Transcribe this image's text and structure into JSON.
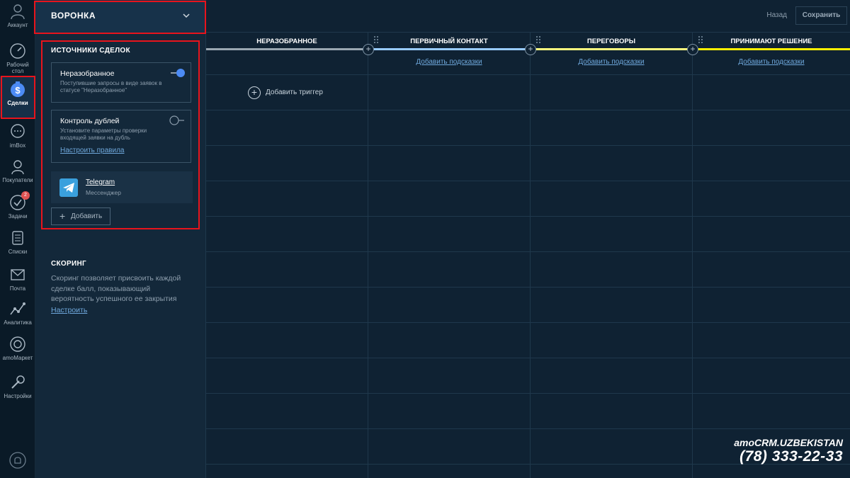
{
  "nav": {
    "account": "Аккаунт",
    "items": [
      {
        "label": "Рабочий стол",
        "icon": "dashboard-icon"
      },
      {
        "label": "Сделки",
        "icon": "deals-icon"
      },
      {
        "label": "imBox",
        "icon": "chat-icon"
      },
      {
        "label": "Покупатели",
        "icon": "customers-icon"
      },
      {
        "label": "Задачи",
        "icon": "tasks-icon",
        "badge": "2"
      },
      {
        "label": "Списки",
        "icon": "lists-icon"
      },
      {
        "label": "Почта",
        "icon": "mail-icon"
      },
      {
        "label": "Аналитика",
        "icon": "analytics-icon"
      },
      {
        "label": "amoМаркет",
        "icon": "market-icon"
      },
      {
        "label": "Настройки",
        "icon": "settings-icon"
      }
    ]
  },
  "panel": {
    "title": "ВОРОНКА",
    "sources_title": "ИСТОЧНИКИ СДЕЛОК",
    "unsorted": {
      "title": "Неразобранное",
      "desc": "Поступившие запросы в виде заявок в статусе \"Неразобранное\"",
      "enabled": true
    },
    "duplicates": {
      "title": "Контроль дублей",
      "desc": "Установите параметры проверки входящей заявки на дубль",
      "link": "Настроить правила",
      "enabled": false
    },
    "telegram": {
      "name": "Telegram",
      "type": "Мессенджер"
    },
    "add_label": "Добавить",
    "scoring_title": "СКОРИНГ",
    "scoring_desc": "Скоринг позволяет присвоить каждой сделке балл, показывающий вероятность успешного ее закрытия",
    "scoring_link": "Настроить"
  },
  "topbar": {
    "back": "Назад",
    "save": "Сохранить"
  },
  "columns": [
    {
      "name": "НЕРАЗОБРАННОЕ",
      "color": "#9aa7b2"
    },
    {
      "name": "ПЕРВИЧНЫЙ КОНТАКТ",
      "color": "#99ccff",
      "hints": "Добавить подсказки"
    },
    {
      "name": "ПЕРЕГОВОРЫ",
      "color": "#fffd7f",
      "hints": "Добавить подсказки"
    },
    {
      "name": "ПРИНИМАЮТ РЕШЕНИЕ",
      "color": "#fff000",
      "hints": "Добавить подсказки"
    }
  ],
  "trigger_label": "Добавить триггер",
  "watermark": {
    "brand": "amoCRM.UZBEKISTAN",
    "phone": "(78) 333-22-33"
  },
  "colors": {
    "accent": "#4c8bf5",
    "highlight": "#e8141c",
    "link": "#6fa8dc"
  }
}
